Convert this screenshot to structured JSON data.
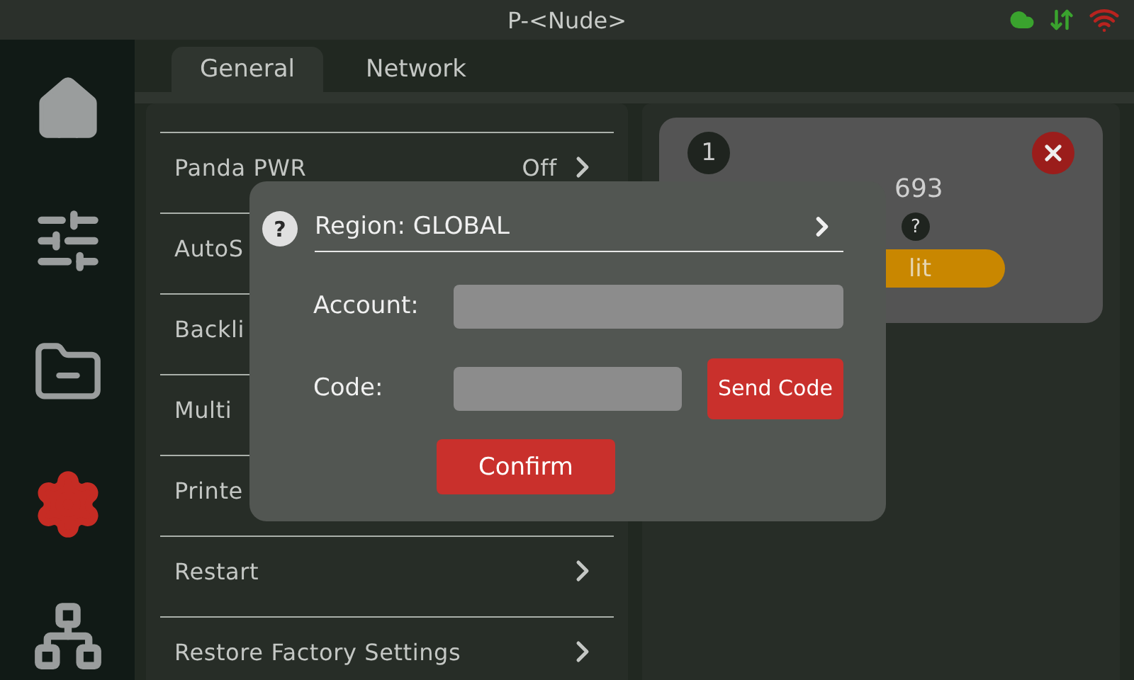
{
  "top_bar": {
    "title": "P-<Nude>",
    "status": [
      {
        "kind": "cloud",
        "color": "#3aa32e"
      },
      {
        "kind": "transfer",
        "color": "#3aa32e"
      },
      {
        "kind": "wifi",
        "color": "#b8231f"
      }
    ]
  },
  "nav": [
    {
      "kind": "home",
      "selected": false
    },
    {
      "kind": "controls",
      "selected": false
    },
    {
      "kind": "files",
      "selected": false
    },
    {
      "kind": "settings",
      "selected": true
    },
    {
      "kind": "network",
      "selected": false
    }
  ],
  "tabs": [
    {
      "label": "General",
      "selected": true
    },
    {
      "label": "Network",
      "selected": false
    }
  ],
  "settings": [
    {
      "label": "Panda PWR",
      "value": "Off",
      "chevron": true
    },
    {
      "label": "AutoS",
      "chevron": false
    },
    {
      "label": "Backli",
      "chevron": false
    },
    {
      "label": "Multi",
      "chevron": false
    },
    {
      "label": "Printe",
      "chevron": false
    },
    {
      "label": "Restart",
      "chevron": true
    },
    {
      "label": "Restore Factory Settings",
      "chevron": true
    }
  ],
  "printer_card": {
    "number": "1",
    "id_fragment": "693",
    "help": "?",
    "button": "lit"
  },
  "dialog": {
    "help": "?",
    "region": "Region: GLOBAL",
    "fields": [
      {
        "label": "Account:",
        "kind": "wide"
      },
      {
        "label": "Code:",
        "kind": "short",
        "button": "Send Code"
      }
    ],
    "confirm": "Confirm"
  }
}
